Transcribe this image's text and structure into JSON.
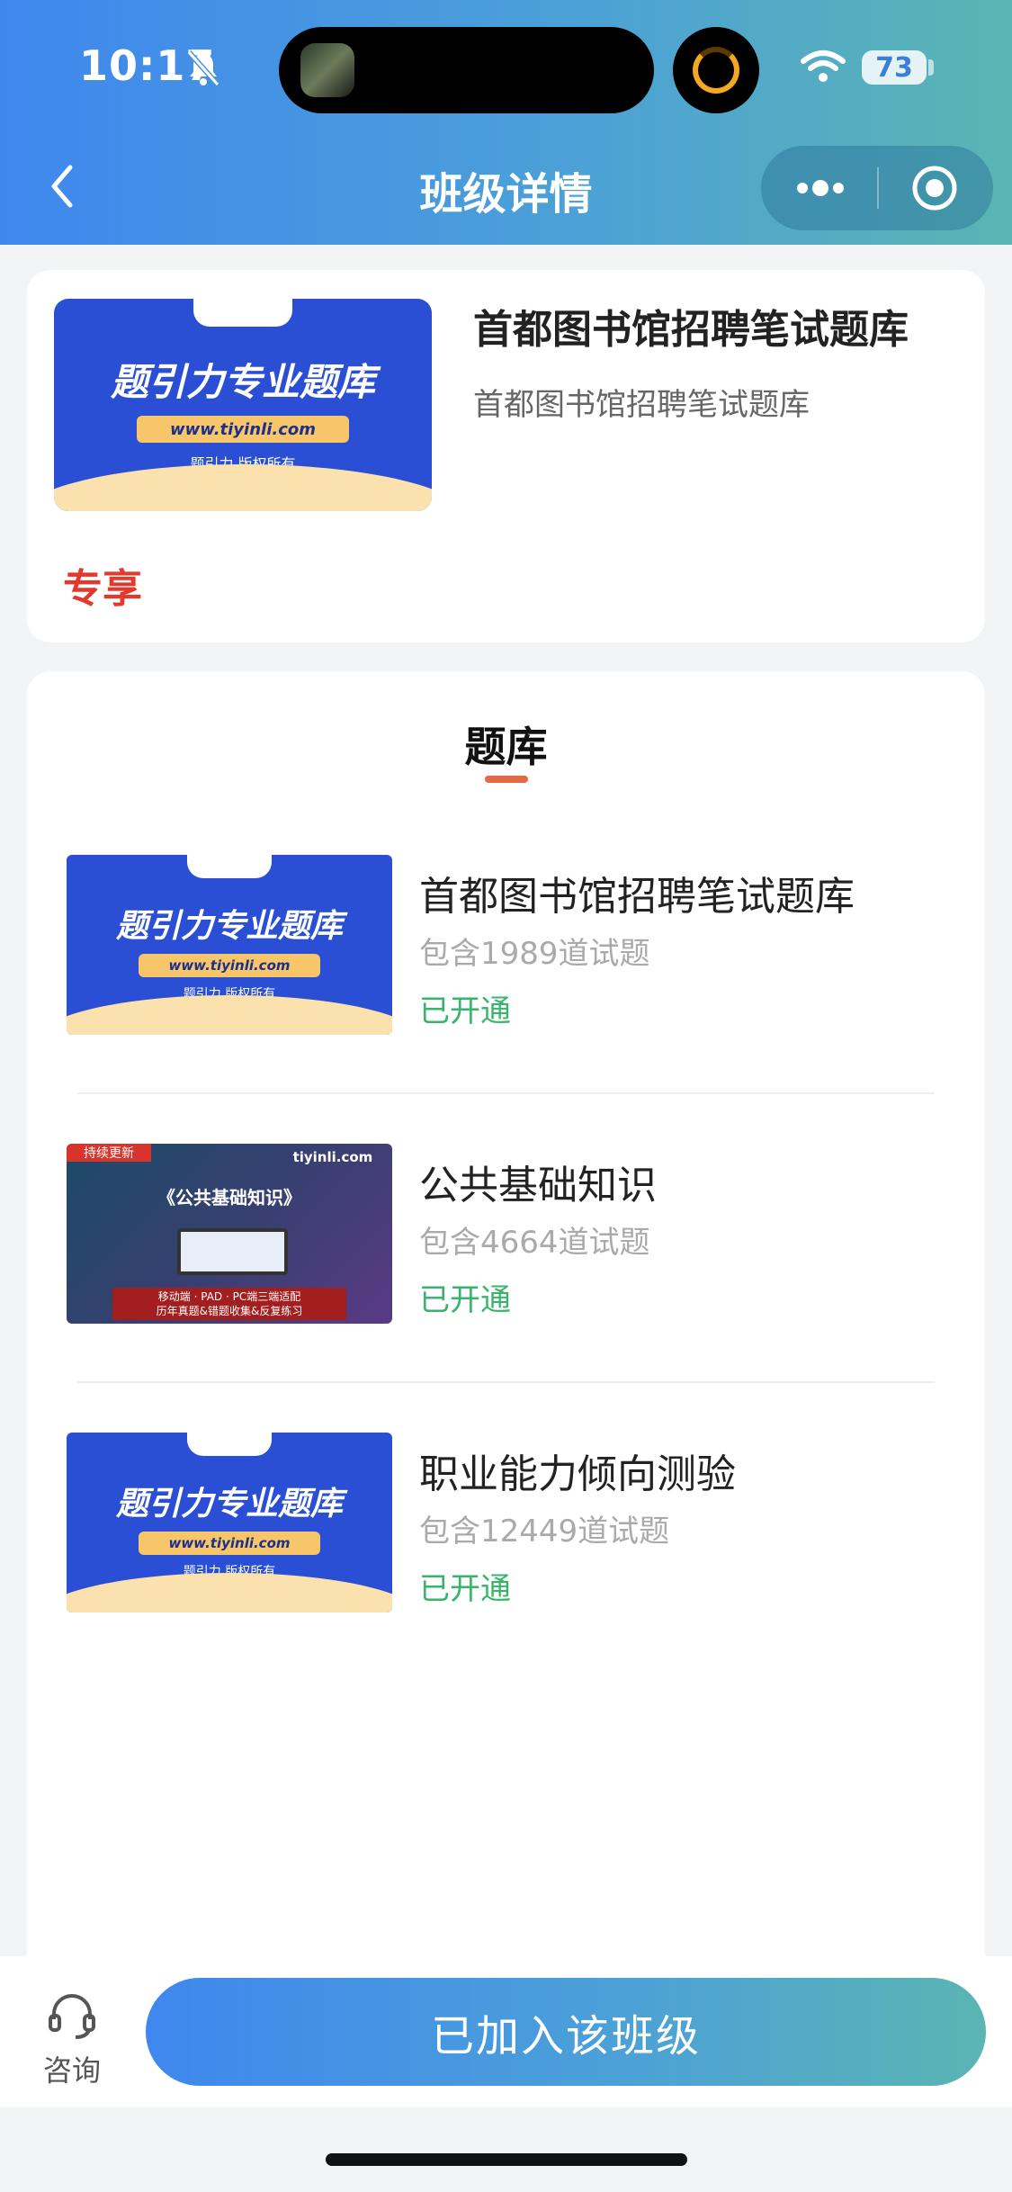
{
  "status_bar": {
    "time": "10:17",
    "battery": "73"
  },
  "nav": {
    "title": "班级详情"
  },
  "class_card": {
    "title": "首都图书馆招聘笔试题库",
    "subtitle": "首都图书馆招聘笔试题库",
    "tag": "专享",
    "cover": {
      "title": "题引力专业题库",
      "url": "www.tiyinli.com",
      "copyright": "题引力 版权所有"
    }
  },
  "section": {
    "title": "题库"
  },
  "items": [
    {
      "name": "首都图书馆招聘笔试题库",
      "count": "包含1989道试题",
      "status": "已开通",
      "cover": {
        "title": "题引力专业题库",
        "url": "www.tiyinli.com",
        "copyright": "题引力 版权所有"
      }
    },
    {
      "name": "公共基础知识",
      "count": "包含4664道试题",
      "status": "已开通",
      "cover": {
        "tag": "持续更新",
        "brand": "tiyinli.com",
        "title": "《公共基础知识》",
        "line1": "移动端 · PAD · PC端三端适配",
        "line2": "历年真题&错题收集&反复练习"
      }
    },
    {
      "name": "职业能力倾向测验",
      "count": "包含12449道试题",
      "status": "已开通",
      "cover": {
        "title": "题引力专业题库",
        "url": "www.tiyinli.com",
        "copyright": "题引力 版权所有"
      }
    }
  ],
  "bottom": {
    "consult_label": "咨询",
    "join_label": "已加入该班级"
  },
  "colors": {
    "accent_start": "#3f87ee",
    "accent_end": "#5ab5b3",
    "status_green": "#36b56b",
    "exclusive_red": "#e2382d"
  }
}
